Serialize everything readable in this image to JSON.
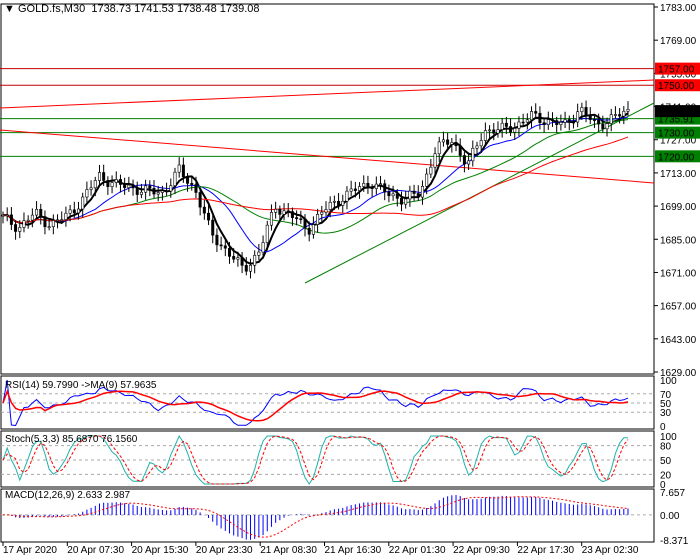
{
  "header": {
    "symbol": "GOLD.fs,M30",
    "ohlc": "1738.73 1741.53 1738.48 1739.08"
  },
  "chart_data": {
    "type": "candlestick",
    "title": "GOLD.fs,M30",
    "ylim": [
      1629,
      1783
    ],
    "y_ticks": [
      1783,
      1769,
      1755,
      1741,
      1727,
      1713,
      1699,
      1685,
      1671,
      1657,
      1643,
      1629
    ],
    "x_ticks": [
      "17 Apr 2020",
      "20 Apr 07:30",
      "20 Apr 15:30",
      "20 Apr 23:30",
      "21 Apr 08:30",
      "21 Apr 16:30",
      "22 Apr 01:30",
      "22 Apr 09:30",
      "22 Apr 17:30",
      "23 Apr 02:30"
    ],
    "close_path": [
      1694,
      1690,
      1696,
      1691,
      1695,
      1702,
      1712,
      1708,
      1707,
      1705,
      1705,
      1714,
      1706,
      1687,
      1680,
      1672,
      1680,
      1699,
      1695,
      1689,
      1697,
      1702,
      1706,
      1709,
      1704,
      1702,
      1704,
      1723,
      1727,
      1716,
      1731,
      1731,
      1733,
      1737,
      1735,
      1733,
      1740,
      1733,
      1736,
      1739
    ],
    "levels": [
      {
        "price": 1757.0,
        "label": "1757.00",
        "color": "#ff0000"
      },
      {
        "price": 1750.0,
        "label": "1750.00",
        "color": "#ff0000"
      },
      {
        "price": 1735.91,
        "label": "1735.91",
        "color": "#008000"
      },
      {
        "price": 1730.0,
        "label": "1730.00",
        "color": "#008000"
      },
      {
        "price": 1720.0,
        "label": "1720.00",
        "color": "#008000"
      }
    ],
    "current_price": "1739.08",
    "indicators": {
      "rsi": {
        "label": "RSI(14) 59.7990  ->MA(9) 57.9635",
        "ticks": [
          "100",
          "70",
          "50",
          "30",
          "0"
        ]
      },
      "stoch": {
        "label": "Stoch(5,3,3) 85.6870 76.1560",
        "ticks": [
          "100",
          "80",
          "50",
          "20",
          "0"
        ]
      },
      "macd": {
        "label": "MACD(12,26,9) 2.633 2.987",
        "ticks": [
          "7.657",
          "0.00",
          "-8.371"
        ]
      }
    },
    "colors": {
      "bull": "#000000",
      "ma_fast": "#000000",
      "ma_mid": "#0000ff",
      "ma_slow": "#008000",
      "ma_long": "#ff0000",
      "signal": "#ff0000"
    }
  }
}
